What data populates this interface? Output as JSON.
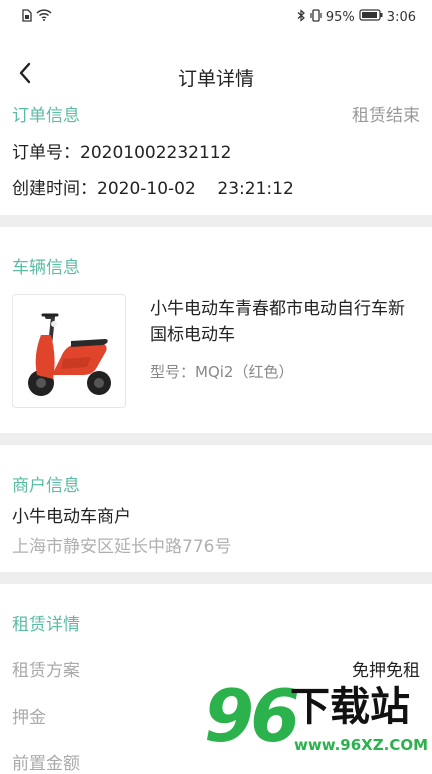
{
  "status_bar": {
    "battery": "95%",
    "time": "3:06"
  },
  "header": {
    "title": "订单详情"
  },
  "order_info": {
    "heading": "订单信息",
    "status": "租赁结束",
    "order_no_label": "订单号：",
    "order_no": "20201002232112",
    "created_label": "创建时间：",
    "created_time": "2020-10-02    23:21:12"
  },
  "vehicle_info": {
    "heading": "车辆信息",
    "name": "小牛电动车青春都市电动自行车新国标电动车",
    "model": "型号：MQi2（红色）"
  },
  "merchant_info": {
    "heading": "商户信息",
    "name": "小牛电动车商户",
    "address": "上海市静安区延长中路776号"
  },
  "rental_details": {
    "heading": "租赁详情",
    "rows": [
      {
        "label": "租赁方案",
        "value": "免押免租"
      },
      {
        "label": "押金",
        "value": ""
      },
      {
        "label": "前置金额",
        "value": ""
      }
    ]
  },
  "watermark": {
    "big": "96",
    "text": "下载站",
    "url": "www.96XZ.COM"
  },
  "colors": {
    "accent": "#5cbba5",
    "divider": "#eeeeee",
    "watermark_green": "#2bb24c"
  }
}
